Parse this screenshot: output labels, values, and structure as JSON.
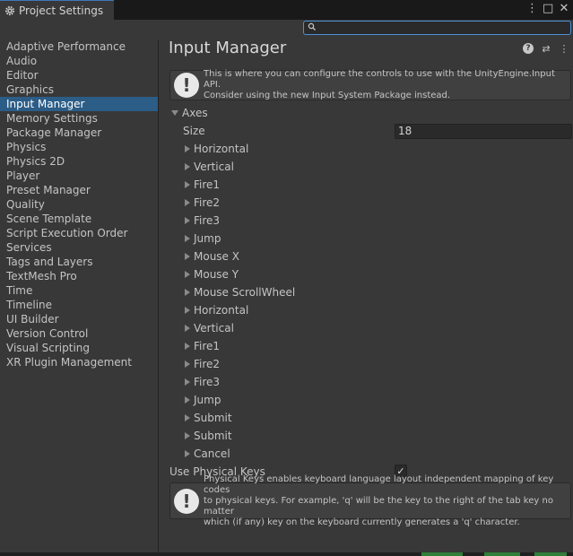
{
  "window": {
    "tab_title": "Project Settings",
    "tab_icon": "gear-icon",
    "titlebar_icons": [
      "kebab-menu-icon",
      "maximize-icon",
      "close-icon"
    ]
  },
  "search": {
    "placeholder": "",
    "value": ""
  },
  "sidebar": {
    "items": [
      {
        "label": "Adaptive Performance"
      },
      {
        "label": "Audio"
      },
      {
        "label": "Editor"
      },
      {
        "label": "Graphics"
      },
      {
        "label": "Input Manager",
        "selected": true
      },
      {
        "label": "Memory Settings"
      },
      {
        "label": "Package Manager"
      },
      {
        "label": "Physics"
      },
      {
        "label": "Physics 2D"
      },
      {
        "label": "Player"
      },
      {
        "label": "Preset Manager"
      },
      {
        "label": "Quality"
      },
      {
        "label": "Scene Template"
      },
      {
        "label": "Script Execution Order"
      },
      {
        "label": "Services"
      },
      {
        "label": "Tags and Layers"
      },
      {
        "label": "TextMesh Pro"
      },
      {
        "label": "Time"
      },
      {
        "label": "Timeline"
      },
      {
        "label": "UI Builder"
      },
      {
        "label": "Version Control"
      },
      {
        "label": "Visual Scripting"
      },
      {
        "label": "XR Plugin Management"
      }
    ]
  },
  "main": {
    "title": "Input Manager",
    "header_icons": [
      "help-icon",
      "preset-icon",
      "kebab-menu-icon"
    ],
    "info_box": {
      "line1": "This is where you can configure the controls to use with the UnityEngine.Input API.",
      "line2": "Consider using the new Input System Package instead."
    },
    "axes": {
      "label": "Axes",
      "size_label": "Size",
      "size_value": "18",
      "items": [
        "Horizontal",
        "Vertical",
        "Fire1",
        "Fire2",
        "Fire3",
        "Jump",
        "Mouse X",
        "Mouse Y",
        "Mouse ScrollWheel",
        "Horizontal",
        "Vertical",
        "Fire1",
        "Fire2",
        "Fire3",
        "Jump",
        "Submit",
        "Submit",
        "Cancel"
      ]
    },
    "physical_keys": {
      "label": "Use Physical Keys",
      "checked": true,
      "check_glyph": "✓"
    },
    "physical_info": {
      "line1": "Physical Keys enables keyboard language layout independent mapping of key codes",
      "line2": "to physical keys. For example, 'q' will be the key to the right of the tab key no matter",
      "line3": "which (if any) key on the keyboard currently generates a 'q' character."
    }
  },
  "colors": {
    "accent": "#2c5d87",
    "search_border": "#4d8ed6",
    "panel": "#383838"
  }
}
